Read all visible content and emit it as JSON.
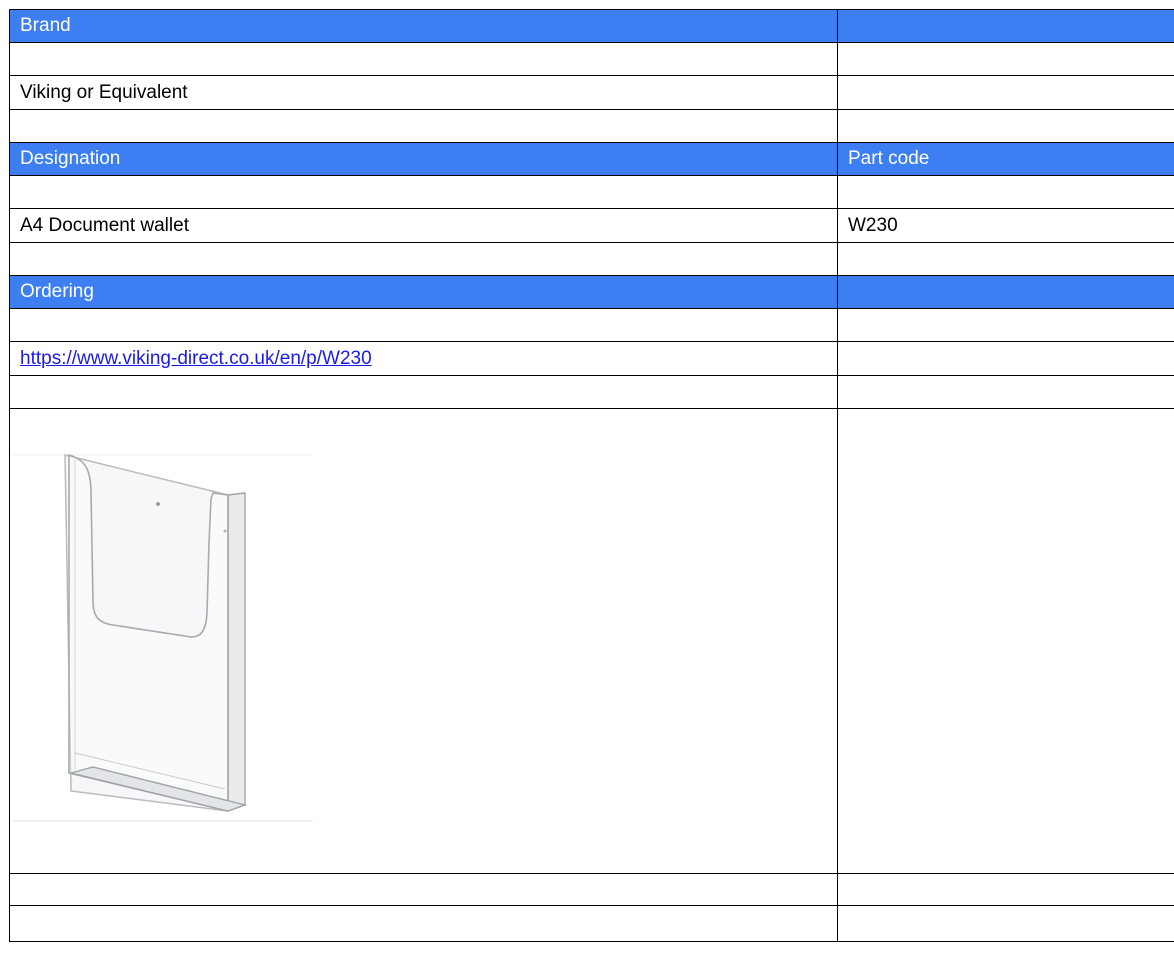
{
  "brand": {
    "header": "Brand",
    "value": "Viking or Equivalent"
  },
  "designation": {
    "header": "Designation",
    "part_code_header": "Part code",
    "value": "A4 Document wallet",
    "part_code": "W230"
  },
  "ordering": {
    "header": "Ordering",
    "url": "https://www.viking-direct.co.uk/en/p/W230"
  },
  "product_image": {
    "icon": "document-wallet-image"
  },
  "colors": {
    "header_bg": "#3d7ff2",
    "header_text": "#ffffff",
    "link": "#1a1aee"
  }
}
